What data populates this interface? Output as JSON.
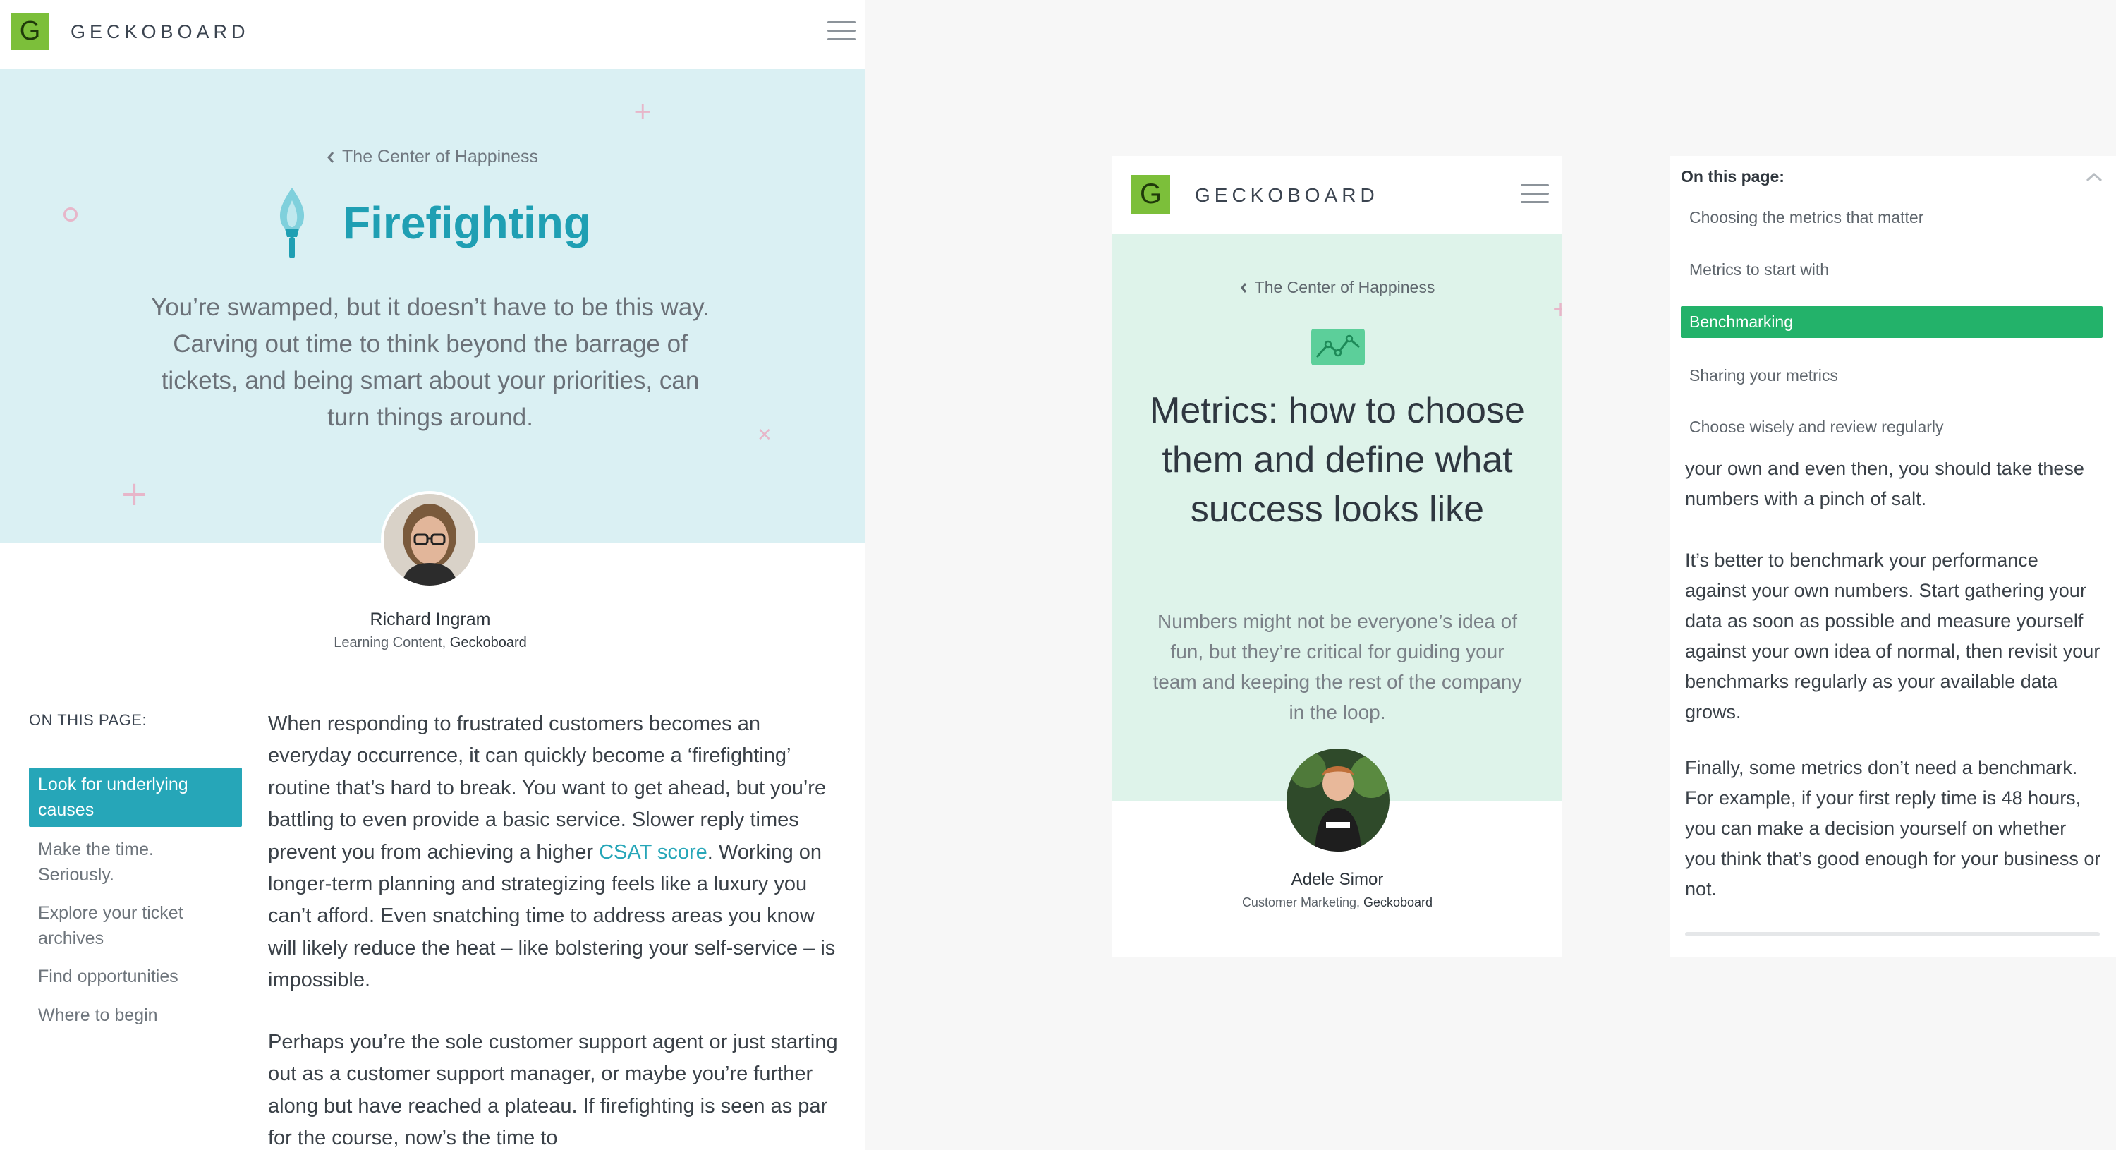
{
  "brand": {
    "logo_letter": "G",
    "name": "GECKOBOARD",
    "logo_color": "#7cbf3a"
  },
  "left": {
    "breadcrumb": "The Center of Happiness",
    "title": "Firefighting",
    "lede": "You’re swamped, but it doesn’t have to be this way. Carving out time to think beyond the barrage of tickets, and being smart about your priorities, can turn things around.",
    "author": {
      "name": "Richard Ingram",
      "role_prefix": "Learning Content, ",
      "company": "Geckoboard"
    },
    "toc": {
      "heading": "ON THIS PAGE:",
      "active": "Look for underlying causes",
      "items": [
        "Make the time. Seriously.",
        "Explore your ticket archives",
        "Find opportunities",
        "Where to begin"
      ]
    },
    "body": {
      "p1_a": "When responding to frustrated customers becomes an everyday occurrence, it can quickly become a ‘firefighting’ routine that’s hard to break. You want to get ahead, but you’re battling to even provide a basic service. Slower reply times prevent you from achieving a higher ",
      "p1_link": "CSAT score",
      "p1_b": ". Working on longer-term planning and strategizing feels like a luxury you can’t afford. Even snatching time to address areas you know will likely reduce the heat – like bolstering your self-service – is impossible.",
      "p2": "Perhaps you’re the sole customer support agent or just starting out as a customer support manager, or maybe you’re further along but have reached a plateau. If firefighting is seen as par for the course, now’s the time to"
    },
    "accent": "#26a6b8"
  },
  "middle": {
    "breadcrumb": "The Center of Happiness",
    "icon": "line-chart-icon",
    "title": "Metrics: how to choose them and define what success looks like",
    "lede": "Numbers might not be everyone’s idea of fun, but they’re critical for guiding your team and keeping the rest of the company in the loop.",
    "author": {
      "name": "Adele Simor",
      "role_prefix": "Customer Marketing, ",
      "company": "Geckoboard"
    }
  },
  "right": {
    "toc": {
      "heading": "On this page:",
      "items": [
        "Choosing the metrics that matter",
        "Metrics to start with"
      ],
      "active": "Benchmarking",
      "items_after": [
        "Sharing your metrics",
        "Choose wisely and review regularly"
      ]
    },
    "body": {
      "p1": "your own and even then, you should take these numbers with a pinch of salt.",
      "p2": "It’s better to benchmark your performance against your own numbers. Start gathering your data as soon as possible and measure yourself against your own idea of normal, then revisit your benchmarks regularly as your available data grows.",
      "p3": "Finally, some metrics don’t need a benchmark. For example, if your first reply time is 48 hours, you can make a decision yourself on whether you think that’s good enough for your business or not."
    },
    "accent": "#23b26a"
  }
}
